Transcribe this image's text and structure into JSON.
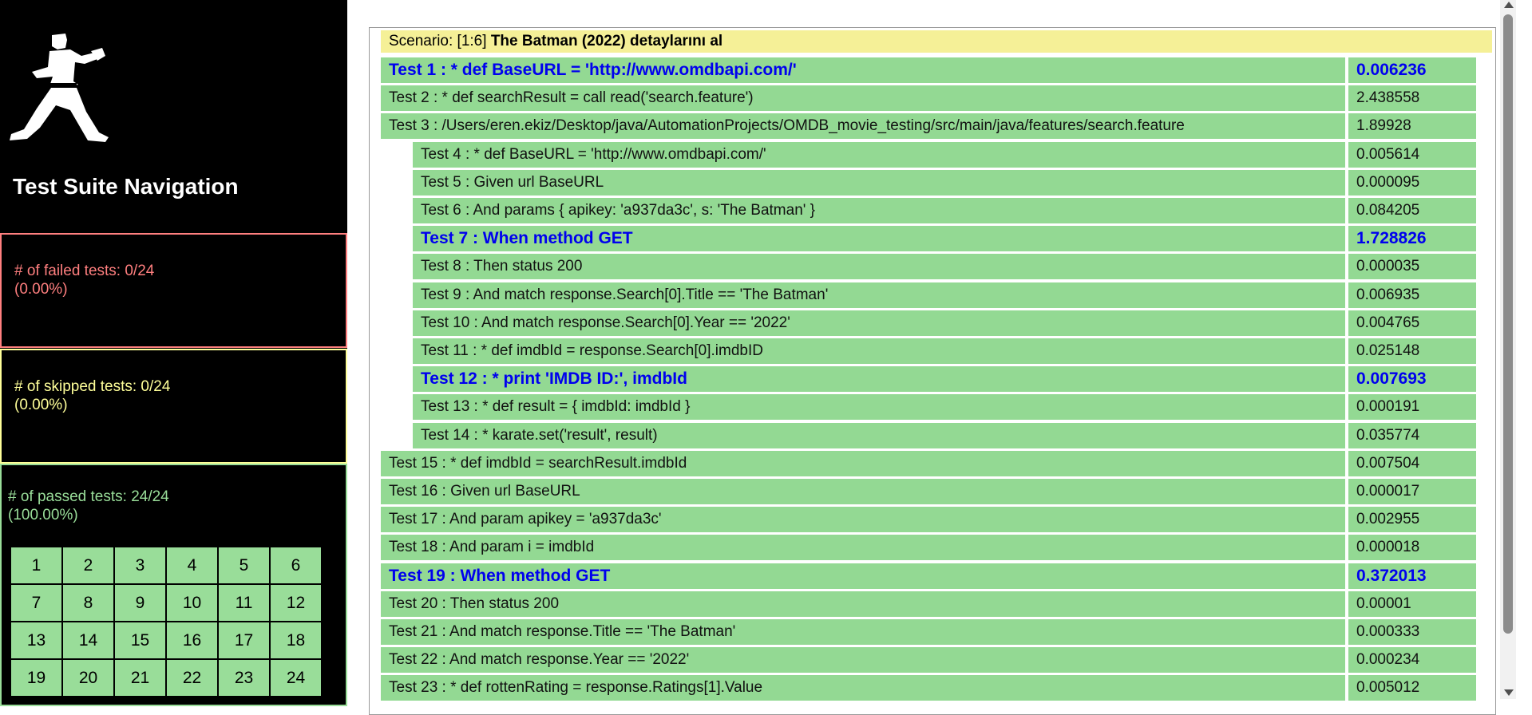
{
  "sidebar": {
    "logo_icon": "karate-man-icon",
    "title": "Test Suite Navigation",
    "failed": {
      "line1": "# of failed tests: 0/24",
      "line2": "(0.00%)",
      "color": "#ff7f7f"
    },
    "skipped": {
      "line1": "# of skipped tests: 0/24",
      "line2": "(0.00%)",
      "color": "#ffff99"
    },
    "passed": {
      "line1": "# of passed tests: 24/24",
      "line2": "(100.00%)",
      "color": "#99dd99"
    },
    "test_numbers": [
      "1",
      "2",
      "3",
      "4",
      "5",
      "6",
      "7",
      "8",
      "9",
      "10",
      "11",
      "12",
      "13",
      "14",
      "15",
      "16",
      "17",
      "18",
      "19",
      "20",
      "21",
      "22",
      "23",
      "24"
    ]
  },
  "scenario": {
    "prefix": "Scenario: [1:6]",
    "name": "The Batman (2022) detaylarını al",
    "background_color": "#f5f097"
  },
  "steps": [
    {
      "text": "Test 1 : * def BaseURL = 'http://www.omdbapi.com/'",
      "time": "0.006236",
      "highlight": true
    },
    {
      "text": "Test 2 : * def searchResult = call read('search.feature')",
      "time": "2.438558"
    },
    {
      "text": "Test 3 : /Users/eren.ekiz/Desktop/java/AutomationProjects/OMDB_movie_testing/src/main/java/features/search.feature",
      "time": "1.89928"
    },
    {
      "text": "Test 4 : * def BaseURL = 'http://www.omdbapi.com/'",
      "time": "0.005614"
    },
    {
      "text": "Test 5 : Given url BaseURL",
      "time": "0.000095"
    },
    {
      "text": "Test 6 : And params { apikey: 'a937da3c', s: 'The Batman' }",
      "time": "0.084205"
    },
    {
      "text": "Test 7 : When method GET",
      "time": "1.728826",
      "highlight": true
    },
    {
      "text": "Test 8 : Then status 200",
      "time": "0.000035"
    },
    {
      "text": "Test 9 : And match response.Search[0].Title == 'The Batman'",
      "time": "0.006935"
    },
    {
      "text": "Test 10 : And match response.Search[0].Year == '2022'",
      "time": "0.004765"
    },
    {
      "text": "Test 11 : * def imdbId = response.Search[0].imdbID",
      "time": "0.025148"
    },
    {
      "text": "Test 12 : * print 'IMDB ID:', imdbId",
      "time": "0.007693",
      "highlight": true
    },
    {
      "text": "Test 13 : * def result = { imdbId: imdbId }",
      "time": "0.000191"
    },
    {
      "text": "Test 14 : * karate.set('result', result)",
      "time": "0.035774"
    },
    {
      "text": "Test 15 : * def imdbId = searchResult.imdbId",
      "time": "0.007504"
    },
    {
      "text": "Test 16 : Given url BaseURL",
      "time": "0.000017"
    },
    {
      "text": "Test 17 : And param apikey = 'a937da3c'",
      "time": "0.002955"
    },
    {
      "text": "Test 18 : And param i = imdbId",
      "time": "0.000018"
    },
    {
      "text": "Test 19 : When method GET",
      "time": "0.372013",
      "highlight": true
    },
    {
      "text": "Test 20 : Then status 200",
      "time": "0.00001"
    },
    {
      "text": "Test 21 : And match response.Title == 'The Batman'",
      "time": "0.000333"
    },
    {
      "text": "Test 22 : And match response.Year == '2022'",
      "time": "0.000234"
    },
    {
      "text": "Test 23 : * def rottenRating = response.Ratings[1].Value",
      "time": "0.005012"
    }
  ],
  "colors": {
    "step_pass": "#93d993",
    "highlight_text": "#0000ee"
  }
}
